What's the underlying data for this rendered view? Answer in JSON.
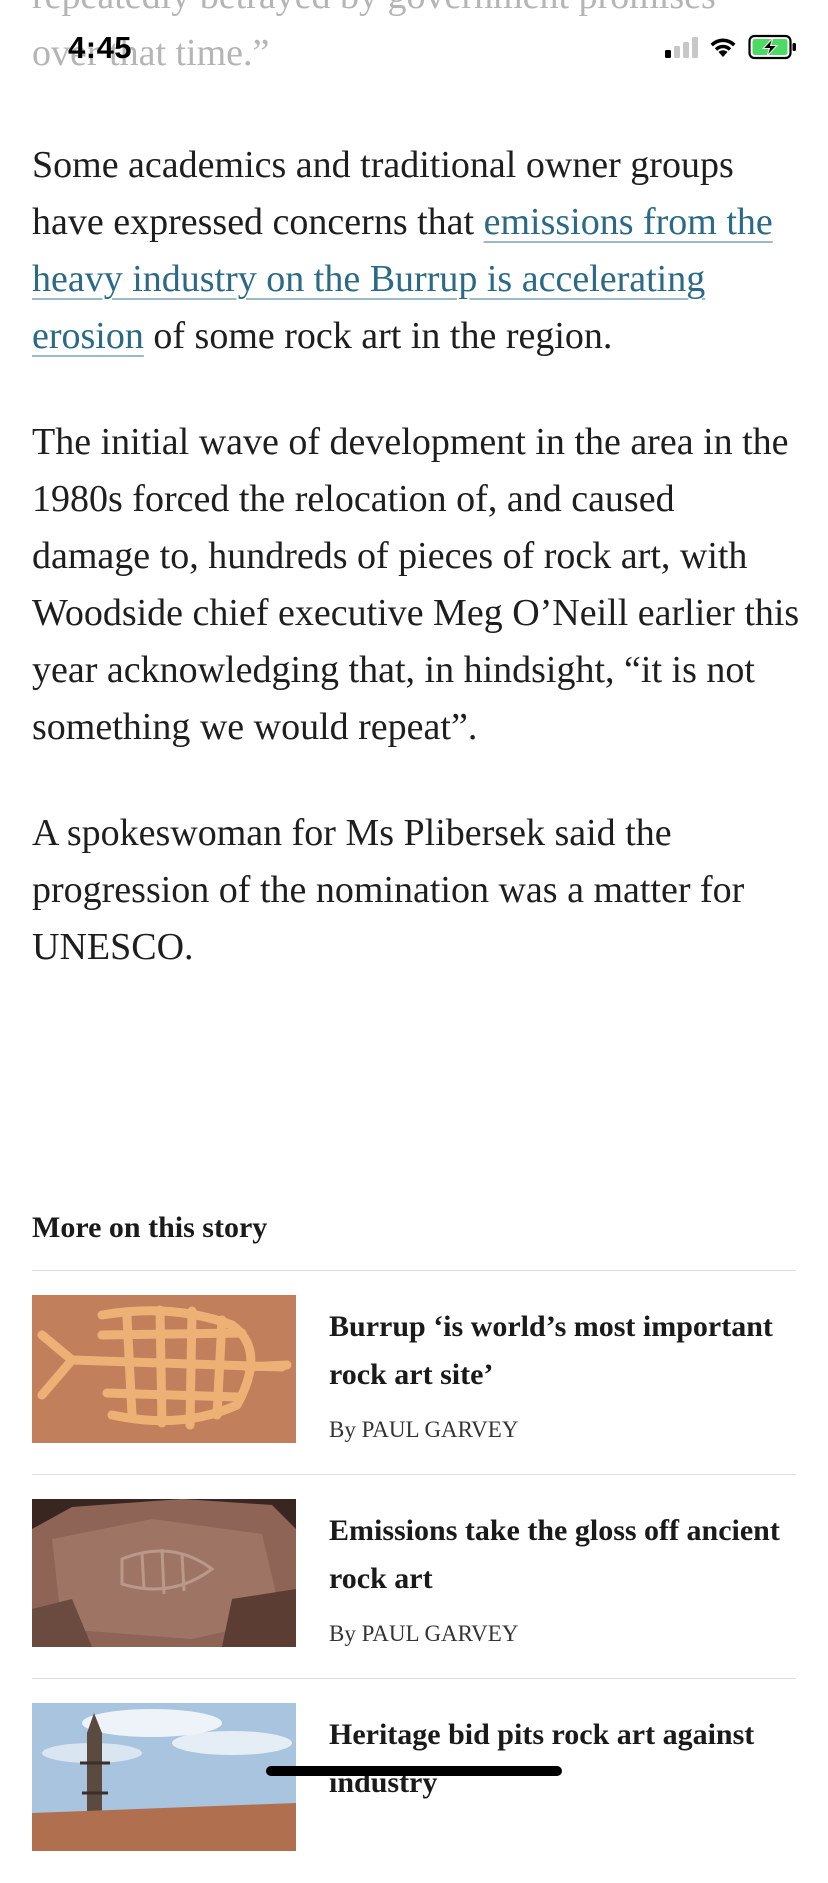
{
  "status_bar": {
    "time": "4:45"
  },
  "faded_top": {
    "line1": "repeatedly betrayed by government promises",
    "line2": "over that time.”"
  },
  "article": {
    "p1_before_link": "Some academics and traditional owner groups have expressed concerns that ",
    "p1_link": "emissions from the heavy industry on the Burrup is accelerating erosion",
    "p1_after_link": " of some rock art in the region.",
    "p2": "The initial wave of development in the area in the 1980s forced the relocation of, and caused damage to, hundreds of pieces of rock art, with Woodside chief executive Meg O’Neill earlier this year acknowledging that, in hindsight, “it is not something we would repeat”.",
    "p3": "A spokeswoman for Ms Plibersek said the progression of the nomination was a matter for UNESCO."
  },
  "more_on_story": {
    "heading": "More on this story",
    "stories": [
      {
        "title": "Burrup ‘is world’s most important rock art site’",
        "byline_prefix": "By",
        "author": "PAUL GARVEY"
      },
      {
        "title": "Emissions take the gloss off ancient rock art",
        "byline_prefix": "By",
        "author": "PAUL GARVEY"
      },
      {
        "title": "Heritage bid pits rock art against industry"
      }
    ]
  },
  "colors": {
    "link": "#2b6a86",
    "text": "#1e1e1e",
    "faded": "#b5b5b5",
    "divider": "#dcdcdc"
  }
}
